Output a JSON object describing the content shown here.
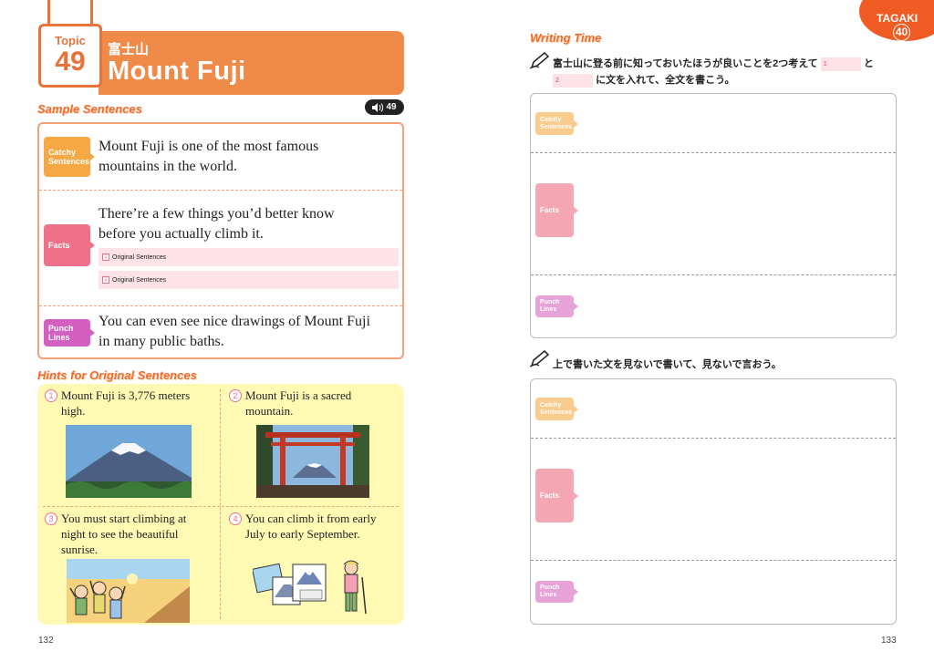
{
  "left_page": {
    "topic_label": "Topic",
    "topic_number": "49",
    "title_jp": "富士山",
    "title_en": "Mount Fuji",
    "sample_heading": "Sample Sentences",
    "audio_track": "49",
    "catchy_tag": [
      "Catchy",
      "Sentences"
    ],
    "facts_tag": "Facts",
    "punch_tag": [
      "Punch",
      "Lines"
    ],
    "catchy_sentence": [
      "Mount Fuji is one of the most famous",
      "mountains in the world."
    ],
    "facts_sentence": [
      "There’re a few things you’d better know",
      "before you actually climb it."
    ],
    "original_lines": [
      {
        "num": "1",
        "label": "Original Sentences"
      },
      {
        "num": "2",
        "label": "Original Sentences"
      }
    ],
    "punch_sentence": [
      "You can even see nice drawings of Mount Fuji",
      "in many public baths."
    ],
    "hints_heading": "Hints for Original Sentences",
    "hints": [
      {
        "num": "1",
        "text": [
          "Mount Fuji is 3,776 meters",
          "high."
        ]
      },
      {
        "num": "2",
        "text": [
          "Mount Fuji is a sacred",
          "mountain."
        ]
      },
      {
        "num": "3",
        "text": [
          "You must start climbing at",
          "night to see the beautiful",
          "sunrise."
        ]
      },
      {
        "num": "4",
        "text": [
          " You can climb it from early",
          "July to early September."
        ]
      }
    ],
    "page_number": "132"
  },
  "right_page": {
    "tagaki_label": "TAGAKI",
    "tagaki_number": "40",
    "writing_heading": "Writing Time",
    "instruction_1": [
      "富士山に登る前に知っておいたほうが良いことを2つ考えて",
      "と",
      "に文を入れて、全文を書こう。"
    ],
    "blank_1": "1",
    "blank_2": "2",
    "instruction_2": "上で書いた文を見ないで書いて、見ないで言おう。",
    "catchy_tag": [
      "Catchy",
      "Sentences"
    ],
    "facts_tag": "Facts",
    "punch_tag": [
      "Punch",
      "Lines"
    ],
    "page_number": "133"
  },
  "colors": {
    "accent": "#ef8a48",
    "catchy": "#f5a844",
    "facts": "#ef7089",
    "punch": "#d35fc0",
    "hint_bg": "#fffab3"
  }
}
